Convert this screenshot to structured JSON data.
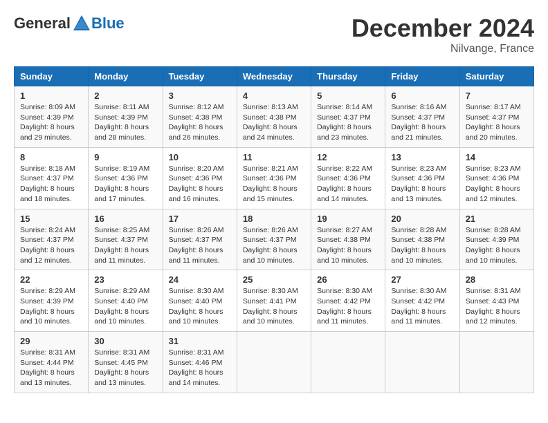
{
  "header": {
    "logo_general": "General",
    "logo_blue": "Blue",
    "month_title": "December 2024",
    "location": "Nilvange, France"
  },
  "days_of_week": [
    "Sunday",
    "Monday",
    "Tuesday",
    "Wednesday",
    "Thursday",
    "Friday",
    "Saturday"
  ],
  "weeks": [
    [
      {
        "day": "1",
        "sunrise": "Sunrise: 8:09 AM",
        "sunset": "Sunset: 4:39 PM",
        "daylight": "Daylight: 8 hours and 29 minutes."
      },
      {
        "day": "2",
        "sunrise": "Sunrise: 8:11 AM",
        "sunset": "Sunset: 4:39 PM",
        "daylight": "Daylight: 8 hours and 28 minutes."
      },
      {
        "day": "3",
        "sunrise": "Sunrise: 8:12 AM",
        "sunset": "Sunset: 4:38 PM",
        "daylight": "Daylight: 8 hours and 26 minutes."
      },
      {
        "day": "4",
        "sunrise": "Sunrise: 8:13 AM",
        "sunset": "Sunset: 4:38 PM",
        "daylight": "Daylight: 8 hours and 24 minutes."
      },
      {
        "day": "5",
        "sunrise": "Sunrise: 8:14 AM",
        "sunset": "Sunset: 4:37 PM",
        "daylight": "Daylight: 8 hours and 23 minutes."
      },
      {
        "day": "6",
        "sunrise": "Sunrise: 8:16 AM",
        "sunset": "Sunset: 4:37 PM",
        "daylight": "Daylight: 8 hours and 21 minutes."
      },
      {
        "day": "7",
        "sunrise": "Sunrise: 8:17 AM",
        "sunset": "Sunset: 4:37 PM",
        "daylight": "Daylight: 8 hours and 20 minutes."
      }
    ],
    [
      {
        "day": "8",
        "sunrise": "Sunrise: 8:18 AM",
        "sunset": "Sunset: 4:37 PM",
        "daylight": "Daylight: 8 hours and 18 minutes."
      },
      {
        "day": "9",
        "sunrise": "Sunrise: 8:19 AM",
        "sunset": "Sunset: 4:36 PM",
        "daylight": "Daylight: 8 hours and 17 minutes."
      },
      {
        "day": "10",
        "sunrise": "Sunrise: 8:20 AM",
        "sunset": "Sunset: 4:36 PM",
        "daylight": "Daylight: 8 hours and 16 minutes."
      },
      {
        "day": "11",
        "sunrise": "Sunrise: 8:21 AM",
        "sunset": "Sunset: 4:36 PM",
        "daylight": "Daylight: 8 hours and 15 minutes."
      },
      {
        "day": "12",
        "sunrise": "Sunrise: 8:22 AM",
        "sunset": "Sunset: 4:36 PM",
        "daylight": "Daylight: 8 hours and 14 minutes."
      },
      {
        "day": "13",
        "sunrise": "Sunrise: 8:23 AM",
        "sunset": "Sunset: 4:36 PM",
        "daylight": "Daylight: 8 hours and 13 minutes."
      },
      {
        "day": "14",
        "sunrise": "Sunrise: 8:23 AM",
        "sunset": "Sunset: 4:36 PM",
        "daylight": "Daylight: 8 hours and 12 minutes."
      }
    ],
    [
      {
        "day": "15",
        "sunrise": "Sunrise: 8:24 AM",
        "sunset": "Sunset: 4:37 PM",
        "daylight": "Daylight: 8 hours and 12 minutes."
      },
      {
        "day": "16",
        "sunrise": "Sunrise: 8:25 AM",
        "sunset": "Sunset: 4:37 PM",
        "daylight": "Daylight: 8 hours and 11 minutes."
      },
      {
        "day": "17",
        "sunrise": "Sunrise: 8:26 AM",
        "sunset": "Sunset: 4:37 PM",
        "daylight": "Daylight: 8 hours and 11 minutes."
      },
      {
        "day": "18",
        "sunrise": "Sunrise: 8:26 AM",
        "sunset": "Sunset: 4:37 PM",
        "daylight": "Daylight: 8 hours and 10 minutes."
      },
      {
        "day": "19",
        "sunrise": "Sunrise: 8:27 AM",
        "sunset": "Sunset: 4:38 PM",
        "daylight": "Daylight: 8 hours and 10 minutes."
      },
      {
        "day": "20",
        "sunrise": "Sunrise: 8:28 AM",
        "sunset": "Sunset: 4:38 PM",
        "daylight": "Daylight: 8 hours and 10 minutes."
      },
      {
        "day": "21",
        "sunrise": "Sunrise: 8:28 AM",
        "sunset": "Sunset: 4:39 PM",
        "daylight": "Daylight: 8 hours and 10 minutes."
      }
    ],
    [
      {
        "day": "22",
        "sunrise": "Sunrise: 8:29 AM",
        "sunset": "Sunset: 4:39 PM",
        "daylight": "Daylight: 8 hours and 10 minutes."
      },
      {
        "day": "23",
        "sunrise": "Sunrise: 8:29 AM",
        "sunset": "Sunset: 4:40 PM",
        "daylight": "Daylight: 8 hours and 10 minutes."
      },
      {
        "day": "24",
        "sunrise": "Sunrise: 8:30 AM",
        "sunset": "Sunset: 4:40 PM",
        "daylight": "Daylight: 8 hours and 10 minutes."
      },
      {
        "day": "25",
        "sunrise": "Sunrise: 8:30 AM",
        "sunset": "Sunset: 4:41 PM",
        "daylight": "Daylight: 8 hours and 10 minutes."
      },
      {
        "day": "26",
        "sunrise": "Sunrise: 8:30 AM",
        "sunset": "Sunset: 4:42 PM",
        "daylight": "Daylight: 8 hours and 11 minutes."
      },
      {
        "day": "27",
        "sunrise": "Sunrise: 8:30 AM",
        "sunset": "Sunset: 4:42 PM",
        "daylight": "Daylight: 8 hours and 11 minutes."
      },
      {
        "day": "28",
        "sunrise": "Sunrise: 8:31 AM",
        "sunset": "Sunset: 4:43 PM",
        "daylight": "Daylight: 8 hours and 12 minutes."
      }
    ],
    [
      {
        "day": "29",
        "sunrise": "Sunrise: 8:31 AM",
        "sunset": "Sunset: 4:44 PM",
        "daylight": "Daylight: 8 hours and 13 minutes."
      },
      {
        "day": "30",
        "sunrise": "Sunrise: 8:31 AM",
        "sunset": "Sunset: 4:45 PM",
        "daylight": "Daylight: 8 hours and 13 minutes."
      },
      {
        "day": "31",
        "sunrise": "Sunrise: 8:31 AM",
        "sunset": "Sunset: 4:46 PM",
        "daylight": "Daylight: 8 hours and 14 minutes."
      },
      null,
      null,
      null,
      null
    ]
  ]
}
